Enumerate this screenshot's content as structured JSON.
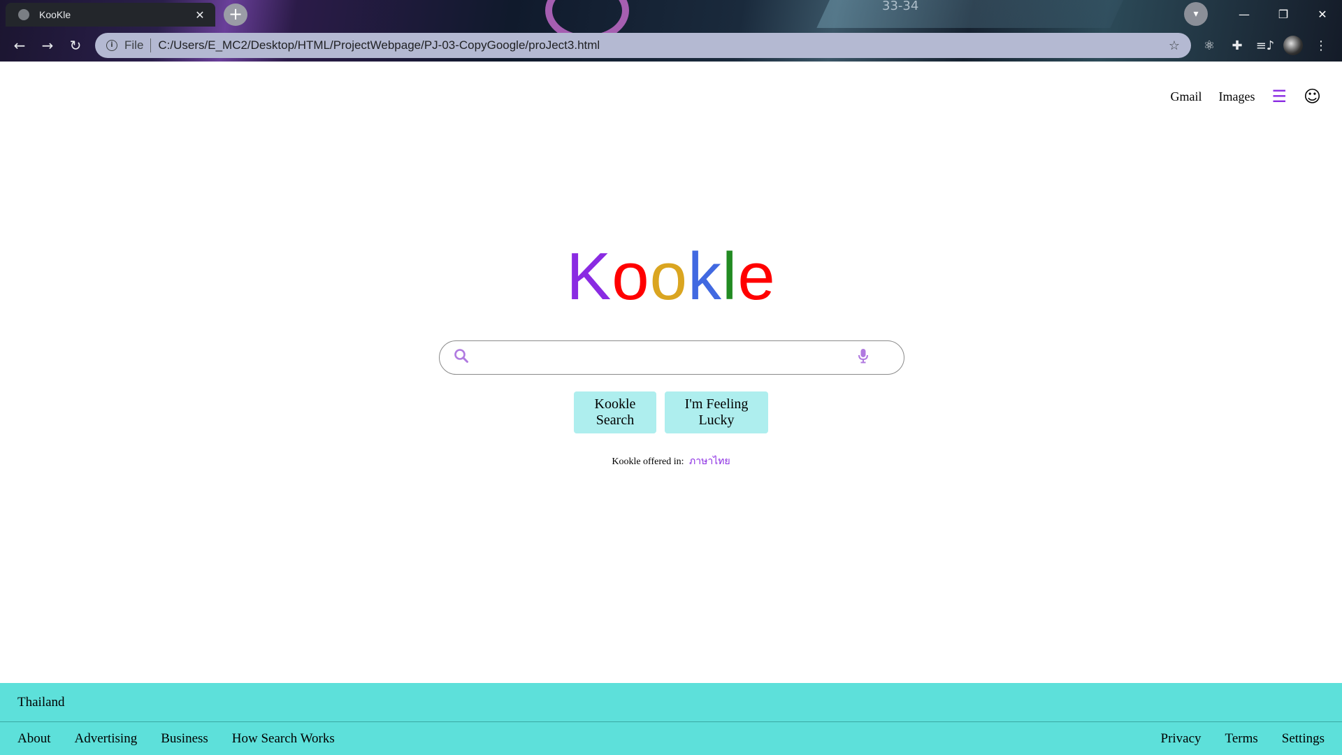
{
  "browser": {
    "tab_title": "KooKle",
    "tab_close": "✕",
    "new_tab": "+",
    "scheme": "File",
    "url": "C:/Users/E_MC2/Desktop/HTML/ProjectWebpage/PJ-03-CopyGoogle/proJect3.html",
    "window_buttons": {
      "minimize": "—",
      "maximize": "❐",
      "close": "✕"
    },
    "nav": {
      "back": "←",
      "forward": "→",
      "reload": "↻"
    },
    "bookmark_star": "☆",
    "extensions": {
      "react": "⚛",
      "puzzle": "✚",
      "media": "≡♪",
      "menu": "⋮"
    },
    "background_text": "33-34"
  },
  "page": {
    "topnav": {
      "gmail": "Gmail",
      "images": "Images",
      "apps_icon": "☰",
      "account_icon": "☺"
    },
    "logo": {
      "letters": [
        "K",
        "o",
        "o",
        "k",
        "l",
        "e"
      ],
      "colors": [
        "#8a2be2",
        "#ff0000",
        "#daa520",
        "#4169e1",
        "#228b22",
        "#ff0000"
      ]
    },
    "search": {
      "placeholder": "",
      "value": "",
      "search_icon": "⚲",
      "mic_icon": "🎙"
    },
    "buttons": {
      "search": "Kookle Search",
      "lucky": "I'm Feeling Lucky"
    },
    "offered": {
      "label": "Kookle offered in:",
      "language": "ภาษาไทย"
    },
    "footer": {
      "country": "Thailand",
      "left_links": [
        "About",
        "Advertising",
        "Business",
        "How Search Works"
      ],
      "right_links": [
        "Privacy",
        "Terms",
        "Settings"
      ]
    },
    "colors": {
      "accent": "#8a2be2",
      "footer_bg": "#5de0da",
      "button_bg": "#aeeeee"
    }
  }
}
